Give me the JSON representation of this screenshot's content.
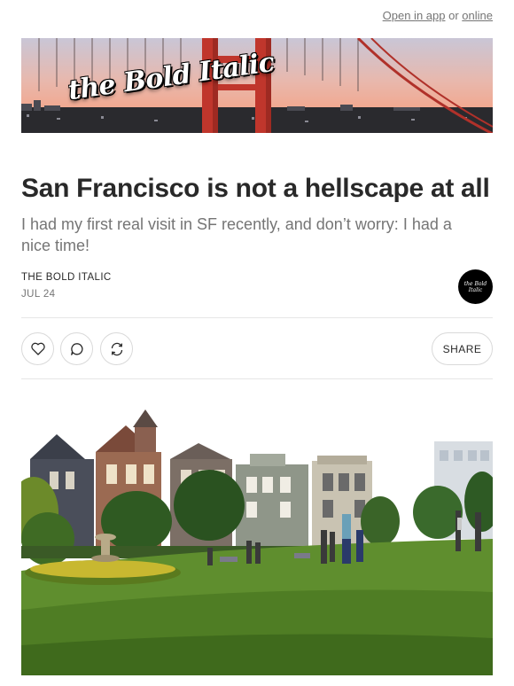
{
  "topbar": {
    "open_in_app": "Open in app",
    "or_text": "or",
    "online": "online"
  },
  "banner": {
    "logo_text": "the Bold Italic"
  },
  "article": {
    "title": "San Francisco is not a hellscape at all",
    "subtitle": "I had my first real visit in SF recently, and don’t worry: I had a nice time!",
    "author": "THE BOLD ITALIC",
    "date": "JUL 24",
    "avatar_text": "the Bold Italic"
  },
  "actions": {
    "like_icon": "heart-icon",
    "comment_icon": "comment-bubble-icon",
    "repost_icon": "repost-arrows-icon",
    "share_label": "SHARE"
  },
  "colors": {
    "text": "#292929",
    "muted": "#757575",
    "border": "#d9d9d9",
    "bridge": "#c0362c"
  }
}
